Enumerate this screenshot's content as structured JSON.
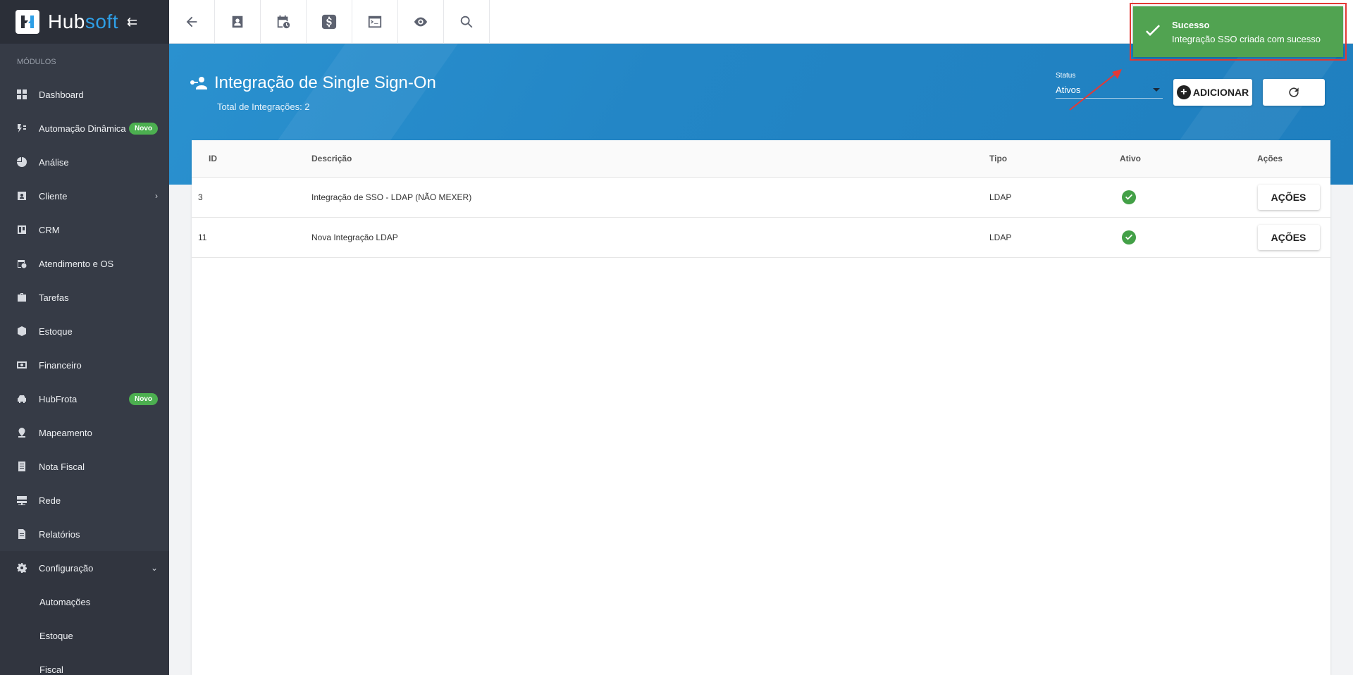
{
  "brand": {
    "name_part1": "Hub",
    "name_part2": "soft",
    "toggle": "⇇"
  },
  "sidebar": {
    "section_label": "MÓDULOS",
    "items": [
      {
        "label": "Dashboard",
        "icon": "dashboard-icon"
      },
      {
        "label": "Automação Dinâmica",
        "icon": "automation-icon",
        "badge": "Novo"
      },
      {
        "label": "Análise",
        "icon": "pie-chart-icon"
      },
      {
        "label": "Cliente",
        "icon": "contact-card-icon",
        "chevron": "›"
      },
      {
        "label": "CRM",
        "icon": "kanban-icon"
      },
      {
        "label": "Atendimento e OS",
        "icon": "calendar-clock-icon"
      },
      {
        "label": "Tarefas",
        "icon": "briefcase-icon"
      },
      {
        "label": "Estoque",
        "icon": "box-icon"
      },
      {
        "label": "Financeiro",
        "icon": "money-icon"
      },
      {
        "label": "HubFrota",
        "icon": "car-icon",
        "badge": "Novo"
      },
      {
        "label": "Mapeamento",
        "icon": "map-pin-icon"
      },
      {
        "label": "Nota Fiscal",
        "icon": "receipt-icon"
      },
      {
        "label": "Rede",
        "icon": "server-icon"
      },
      {
        "label": "Relatórios",
        "icon": "document-icon"
      },
      {
        "label": "Configuração",
        "icon": "gear-icon",
        "chevron": "⌄"
      }
    ],
    "sub_items": [
      "Automações",
      "Estoque",
      "Fiscal"
    ]
  },
  "topbar": {
    "buttons": [
      "back-icon",
      "contact-icon",
      "calendar-icon",
      "dollar-icon",
      "terminal-icon",
      "eye-icon",
      "search-icon"
    ],
    "right_button": "pdf-icon"
  },
  "page": {
    "title": "Integração de Single Sign-On",
    "subtitle": "Total de Integrações: 2",
    "status_label": "Status",
    "status_value": "Ativos",
    "add_label": "ADICIONAR",
    "add_symbol": "+"
  },
  "table": {
    "columns": [
      "ID",
      "Descrição",
      "Tipo",
      "Ativo",
      "Ações"
    ],
    "rows": [
      {
        "id": "3",
        "descricao": "Integração de SSO - LDAP (NÃO MEXER)",
        "tipo": "LDAP",
        "ativo": true,
        "acoes": "AÇÕES"
      },
      {
        "id": "11",
        "descricao": "Nova Integração LDAP",
        "tipo": "LDAP",
        "ativo": true,
        "acoes": "AÇÕES"
      }
    ]
  },
  "toast": {
    "title": "Sucesso",
    "message": "Integração SSO criada com sucesso"
  },
  "colors": {
    "brand_blue": "#2e9fe6",
    "header_blue": "#2386c6",
    "success_green": "#51a351",
    "sidebar_bg": "#363b46",
    "badge_green": "#4caf50",
    "highlight_red": "#e53935"
  }
}
